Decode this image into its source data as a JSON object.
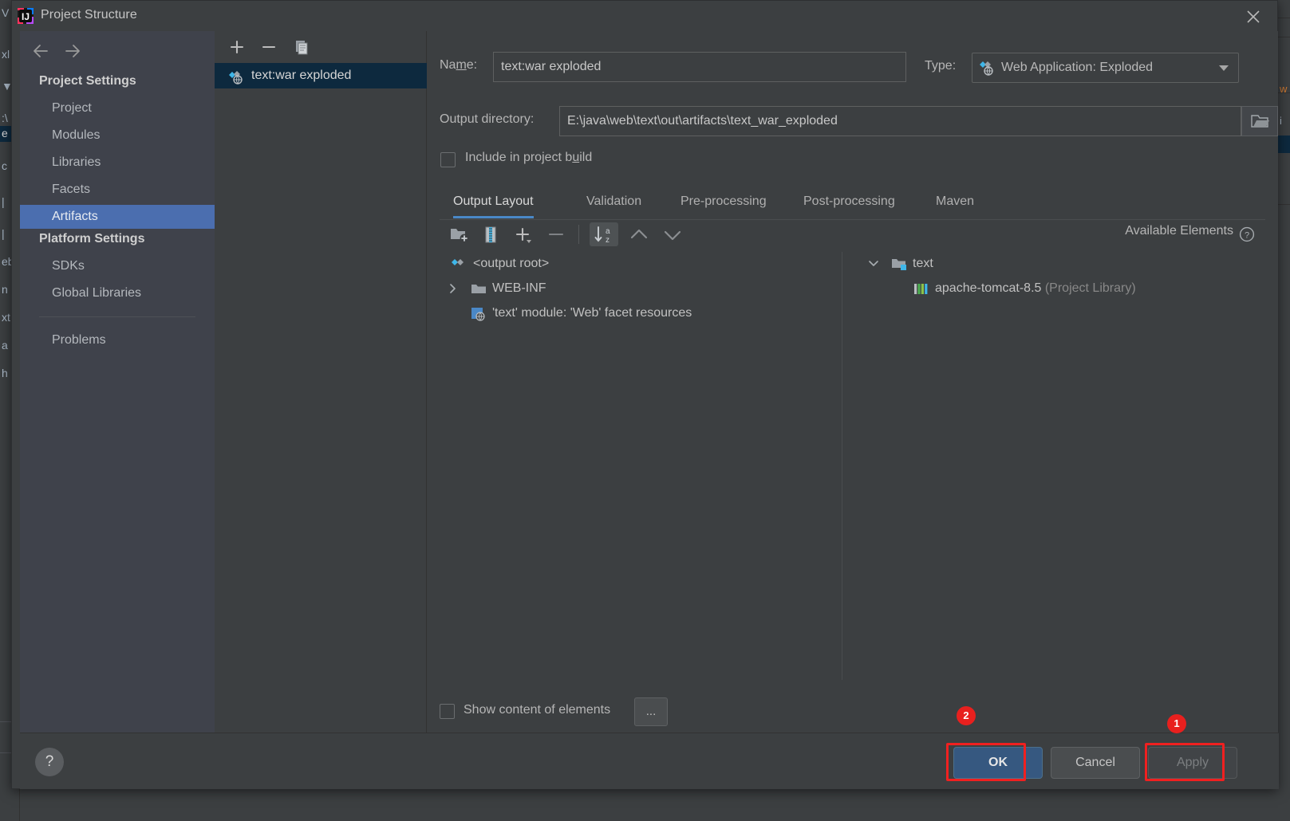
{
  "window": {
    "title": "Project Structure",
    "app_icon": "intellij-idea-icon",
    "close_icon": "close-icon"
  },
  "nav": {
    "back_icon": "arrow-left-icon",
    "forward_icon": "arrow-right-icon",
    "groups": [
      {
        "label": "Project Settings"
      },
      {
        "label": "Platform Settings"
      }
    ],
    "items": [
      {
        "label": "Project",
        "selected": false
      },
      {
        "label": "Modules",
        "selected": false
      },
      {
        "label": "Libraries",
        "selected": false
      },
      {
        "label": "Facets",
        "selected": false
      },
      {
        "label": "Artifacts",
        "selected": true
      },
      {
        "label": "SDKs",
        "selected": false
      },
      {
        "label": "Global Libraries",
        "selected": false
      },
      {
        "label": "Problems",
        "selected": false
      }
    ]
  },
  "artifacts_panel": {
    "toolbar": [
      {
        "name": "add-artifact-button",
        "icon": "plus-icon"
      },
      {
        "name": "remove-artifact-button",
        "icon": "minus-icon"
      },
      {
        "name": "copy-artifact-button",
        "icon": "copy-icon"
      }
    ],
    "items": [
      {
        "label": "text:war exploded",
        "icon": "artifact-icon",
        "selected": true
      }
    ]
  },
  "editor": {
    "name_label": "Name:",
    "name_label_mnemonic": "m",
    "name_value": "text:war exploded",
    "type_label": "Type:",
    "type_value": "Web Application: Exploded",
    "type_icon": "artifact-icon",
    "output_dir_label": "Output directory:",
    "output_dir_value": "E:\\java\\web\\text\\out\\artifacts\\text_war_exploded",
    "browse_icon": "folder-open-icon",
    "include_in_build_label": "Include in project build",
    "include_in_build_mnemonic": "u",
    "include_in_build_checked": false,
    "tabs": [
      {
        "label": "Output Layout",
        "active": true
      },
      {
        "label": "Validation",
        "active": false
      },
      {
        "label": "Pre-processing",
        "active": false
      },
      {
        "label": "Post-processing",
        "active": false
      },
      {
        "label": "Maven",
        "active": false
      }
    ],
    "layout_toolbar": [
      {
        "name": "create-directory-button",
        "icon": "folder-add-icon",
        "pressed": false
      },
      {
        "name": "create-archive-button",
        "icon": "archive-icon",
        "pressed": false
      },
      {
        "name": "add-copy-button",
        "icon": "plus-dropdown-icon",
        "pressed": false
      },
      {
        "name": "remove-element-button",
        "icon": "minus-icon",
        "pressed": false
      },
      {
        "name": "sort-button",
        "icon": "sort-az-icon",
        "pressed": true
      },
      {
        "name": "move-up-button",
        "icon": "arrow-up-icon",
        "pressed": false
      },
      {
        "name": "move-down-button",
        "icon": "arrow-down-icon",
        "pressed": false
      }
    ],
    "available_elements_label": "Available Elements",
    "available_elements_help_icon": "help-circle-icon",
    "output_tree": [
      {
        "label": "<output root>",
        "icon": "artifact-icon",
        "indent": 0,
        "twisty": "none"
      },
      {
        "label": "WEB-INF",
        "icon": "folder-icon",
        "indent": 1,
        "twisty": "collapsed"
      },
      {
        "label": "'text' module: 'Web' facet resources",
        "icon": "web-facet-icon",
        "indent": 1,
        "twisty": "none"
      }
    ],
    "available_tree": [
      {
        "label": "text",
        "suffix": "",
        "icon": "module-folder-icon",
        "indent": 0,
        "twisty": "expanded"
      },
      {
        "label": "apache-tomcat-8.5",
        "suffix": " (Project Library)",
        "icon": "library-icon",
        "indent": 1,
        "twisty": "none"
      }
    ],
    "show_content_label": "Show content of elements",
    "show_content_checked": false,
    "ellipsis_button_label": "..."
  },
  "footer": {
    "help_icon": "help-icon",
    "help_glyph": "?",
    "ok_label": "OK",
    "cancel_label": "Cancel",
    "apply_label": "Apply"
  },
  "annotations": [
    {
      "badge": "1",
      "target": "apply-button"
    },
    {
      "badge": "2",
      "target": "ok-button"
    }
  ],
  "colors": {
    "dialog_bg": "#3c3f41",
    "nav_bg": "#3f424b",
    "selection_blue": "#4b6eaf",
    "list_selection": "#0d293e",
    "accent_tab": "#4a88c7",
    "primary_button": "#365880",
    "annotation_red": "#e8201e"
  },
  "background_window": {
    "left_fragments": [
      "V",
      "xl",
      "▼",
      ":\\",
      "e",
      "c",
      "|",
      "|",
      "eb",
      "n",
      "xt",
      "a",
      "h"
    ],
    "right_fragments": [
      "w",
      "i"
    ]
  }
}
